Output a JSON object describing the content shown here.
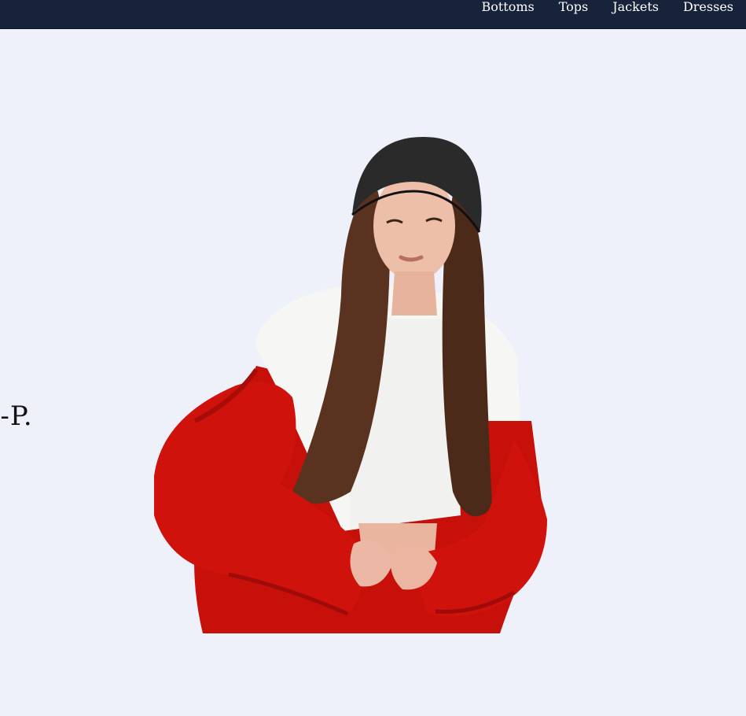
{
  "nav": {
    "items": [
      {
        "label": "Bottoms"
      },
      {
        "label": "Tops"
      },
      {
        "label": "Jackets"
      },
      {
        "label": "Dresses"
      }
    ]
  },
  "hero": {
    "partial_text": "I-P."
  },
  "colors": {
    "navbar_bg": "#16233a",
    "page_bg": "#eef1fa",
    "jacket_red": "#d0120c",
    "hair_brown": "#5a3320",
    "hat_black": "#2a2a2a"
  }
}
